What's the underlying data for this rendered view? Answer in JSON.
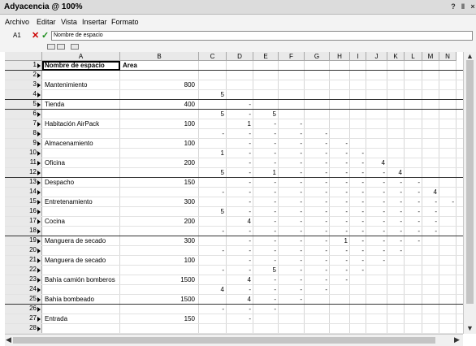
{
  "window": {
    "title": "Adyacencia @ 100%",
    "help": "?",
    "pin": "‖",
    "close": "×"
  },
  "menu": [
    "Archivo",
    "Editar",
    "Vista",
    "Insertar",
    "Formato"
  ],
  "formula": {
    "cell_ref": "A1",
    "cancel": "✕",
    "accept": "✓",
    "value": "Nombre de espacio"
  },
  "columns": [
    "A",
    "B",
    "C",
    "D",
    "E",
    "F",
    "G",
    "H",
    "I",
    "J",
    "K",
    "L",
    "M",
    "N"
  ],
  "rows": [
    {
      "n": "1",
      "name": "Nombre de espacio",
      "area": "Area",
      "cells": {},
      "bold": true
    },
    {
      "n": "2",
      "name": "",
      "area": "",
      "cells": {}
    },
    {
      "n": "3",
      "name": "Mantenimiento",
      "area": "800",
      "cells": {}
    },
    {
      "n": "4",
      "name": "",
      "area": "",
      "cells": {
        "C": "5"
      }
    },
    {
      "n": "5",
      "name": "Tienda",
      "area": "400",
      "cells": {
        "D": "-"
      }
    },
    {
      "n": "6",
      "name": "",
      "area": "",
      "cells": {
        "C": "5",
        "D": "-",
        "E": "5"
      }
    },
    {
      "n": "7",
      "name": "Habitación AirPack",
      "area": "100",
      "cells": {
        "D": "1",
        "E": "-",
        "F": "-"
      }
    },
    {
      "n": "8",
      "name": "",
      "area": "",
      "cells": {
        "C": "-",
        "D": "-",
        "E": "-",
        "F": "-",
        "G": "-"
      }
    },
    {
      "n": "9",
      "name": "Almacenamiento",
      "area": "100",
      "cells": {
        "D": "-",
        "E": "-",
        "F": "-",
        "G": "-",
        "H": "-"
      }
    },
    {
      "n": "10",
      "name": "",
      "area": "",
      "cells": {
        "C": "1",
        "D": "-",
        "E": "-",
        "F": "-",
        "G": "-",
        "H": "-",
        "I": "-"
      }
    },
    {
      "n": "11",
      "name": "Oficina",
      "area": "200",
      "cells": {
        "D": "-",
        "E": "-",
        "F": "-",
        "G": "-",
        "H": "-",
        "I": "-",
        "J": "4"
      }
    },
    {
      "n": "12",
      "name": "",
      "area": "",
      "cells": {
        "C": "5",
        "D": "-",
        "E": "1",
        "F": "-",
        "G": "-",
        "H": "-",
        "I": "-",
        "J": "-",
        "K": "4"
      }
    },
    {
      "n": "13",
      "name": "Despacho",
      "area": "150",
      "cells": {
        "D": "-",
        "E": "-",
        "F": "-",
        "G": "-",
        "H": "-",
        "I": "-",
        "J": "-",
        "K": "-",
        "L": "-"
      }
    },
    {
      "n": "14",
      "name": "",
      "area": "",
      "cells": {
        "C": "-",
        "D": "-",
        "E": "-",
        "F": "-",
        "G": "-",
        "H": "-",
        "I": "-",
        "J": "-",
        "K": "-",
        "L": "-",
        "M": "4"
      }
    },
    {
      "n": "15",
      "name": "Entretenamiento",
      "area": "300",
      "cells": {
        "D": "-",
        "E": "-",
        "F": "-",
        "G": "-",
        "H": "-",
        "I": "-",
        "J": "-",
        "K": "-",
        "L": "-",
        "M": "-",
        "N": "-"
      }
    },
    {
      "n": "16",
      "name": "",
      "area": "",
      "cells": {
        "C": "5",
        "D": "-",
        "E": "-",
        "F": "-",
        "G": "-",
        "H": "-",
        "I": "-",
        "J": "-",
        "K": "-",
        "L": "-",
        "M": "-"
      }
    },
    {
      "n": "17",
      "name": "Cocina",
      "area": "200",
      "cells": {
        "D": "4",
        "E": "-",
        "F": "-",
        "G": "-",
        "H": "-",
        "I": "-",
        "J": "-",
        "K": "-",
        "L": "-",
        "M": "-"
      }
    },
    {
      "n": "18",
      "name": "",
      "area": "",
      "cells": {
        "C": "-",
        "D": "-",
        "E": "-",
        "F": "-",
        "G": "-",
        "H": "-",
        "I": "-",
        "J": "-",
        "K": "-",
        "L": "-",
        "M": "-"
      }
    },
    {
      "n": "19",
      "name": "Manguera de secado",
      "area": "300",
      "cells": {
        "D": "-",
        "E": "-",
        "F": "-",
        "G": "-",
        "H": "1",
        "I": "-",
        "J": "-",
        "K": "-",
        "L": "-"
      }
    },
    {
      "n": "20",
      "name": "",
      "area": "",
      "cells": {
        "C": "-",
        "D": "-",
        "E": "-",
        "F": "-",
        "G": "-",
        "H": "-",
        "I": "-",
        "J": "-",
        "K": "-"
      }
    },
    {
      "n": "21",
      "name": "Manguera de secado",
      "area": "100",
      "cells": {
        "D": "-",
        "E": "-",
        "F": "-",
        "G": "-",
        "H": "-",
        "I": "-",
        "J": "-"
      }
    },
    {
      "n": "22",
      "name": "",
      "area": "",
      "cells": {
        "C": "-",
        "D": "-",
        "E": "5",
        "F": "-",
        "G": "-",
        "H": "-",
        "I": "-"
      }
    },
    {
      "n": "23",
      "name": "Bahía camión bomberos",
      "area": "1500",
      "cells": {
        "D": "4",
        "E": "-",
        "F": "-",
        "G": "-",
        "H": "-"
      }
    },
    {
      "n": "24",
      "name": "",
      "area": "",
      "cells": {
        "C": "4",
        "D": "-",
        "E": "-",
        "F": "-",
        "G": "-"
      }
    },
    {
      "n": "25",
      "name": "Bahía bombeado",
      "area": "1500",
      "cells": {
        "D": "4",
        "E": "-",
        "F": "-"
      }
    },
    {
      "n": "26",
      "name": "",
      "area": "",
      "cells": {
        "C": "-",
        "D": "-",
        "E": "-"
      }
    },
    {
      "n": "27",
      "name": "Entrada",
      "area": "150",
      "cells": {
        "D": "-"
      }
    },
    {
      "n": "28",
      "name": "",
      "area": "",
      "cells": {}
    }
  ]
}
